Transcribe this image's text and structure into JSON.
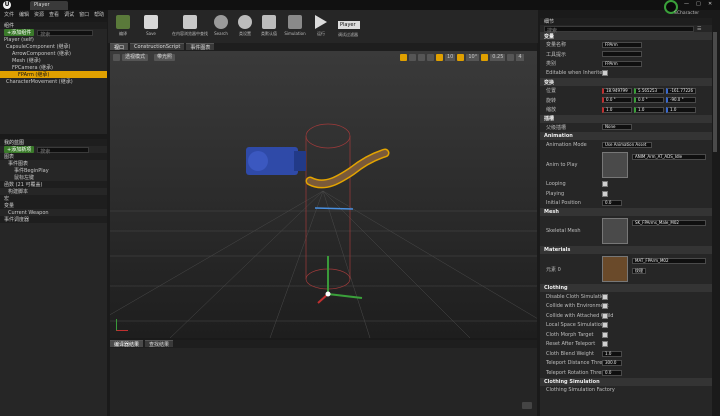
{
  "titlebar": {
    "tab_label": "Player",
    "user_label": "SCharacter"
  },
  "menu": [
    "文件",
    "编辑",
    "资源",
    "查看",
    "调试",
    "窗口",
    "帮助"
  ],
  "toolbar": {
    "buttons": [
      {
        "label": "编译"
      },
      {
        "label": "Save"
      },
      {
        "label": "在内容浏览器中查找"
      },
      {
        "label": "Search"
      },
      {
        "label": "类设置"
      },
      {
        "label": "类默认值"
      },
      {
        "label": "Simulation"
      },
      {
        "label": "运行"
      }
    ],
    "debug_select": "Player",
    "debug_filter": "调试过滤器"
  },
  "components": {
    "header": "组件",
    "add_button": "+添加组件",
    "search_placeholder": "搜索",
    "items": [
      "Player (self)",
      "CapsuleComponent (继承)",
      "ArrowComponent (继承)",
      "Mesh (继承)",
      "FPCamera (继承)",
      "FPArm (继承)",
      "CharacterMovement (继承)"
    ]
  },
  "mybp": {
    "header": "我的蓝图",
    "add_button": "+添加新项",
    "search_placeholder": "搜索",
    "sections": [
      {
        "label": "图表"
      },
      {
        "label": "事件图表"
      },
      {
        "label": "事件BeginPlay"
      },
      {
        "label": "鼠标左键"
      },
      {
        "label": "函数 (21 可覆盖)"
      },
      {
        "label": "构建脚本"
      },
      {
        "label": "宏"
      },
      {
        "label": "变量"
      },
      {
        "label": "Current Weapon"
      },
      {
        "label": "事件调度器"
      }
    ]
  },
  "viewport": {
    "tabs": [
      "视口",
      "ConstructionScript",
      "事件图表"
    ],
    "perspective": "透视模式",
    "lit": "带光照",
    "snap_values": [
      "10",
      "10°",
      "0.25",
      "4"
    ]
  },
  "bottom": {
    "tabs": [
      "编译器结果",
      "查找结果"
    ]
  },
  "details": {
    "tab_label": "细节",
    "search_placeholder": "搜索",
    "sections": {
      "variable": "变量",
      "transform": "变换",
      "sockets": "插槽",
      "animation": "Animation",
      "mesh": "Mesh",
      "materials": "Materials",
      "clothing": "Clothing",
      "clothing_sim": "Clothing Simulation"
    },
    "variable": {
      "name_label": "变量名称",
      "name_value": "FPArm",
      "tooltip_label": "工具提示",
      "category_label": "类别",
      "category_value": "FPArm",
      "editable_label": "Editable when Inherited"
    },
    "transform": {
      "location_label": "位置",
      "rotation_label": "旋转",
      "scale_label": "缩放",
      "location": [
        "18.949799",
        "5.565253",
        "-161.77226"
      ],
      "rotation": [
        "0.0 °",
        "0.0 °",
        "-90.0 °"
      ],
      "scale": [
        "1.0",
        "1.0",
        "1.0"
      ]
    },
    "sockets": {
      "label": "父级插槽",
      "value": "None"
    },
    "animation": {
      "mode_label": "Animation Mode",
      "mode_value": "Use Animation Asset",
      "anim_label": "Anim to Play",
      "anim_value": "ANIM_Arm_AT_ADS_Idle",
      "looping_label": "Looping",
      "playing_label": "Playing",
      "initial_label": "Initial Position",
      "initial_value": "0.0"
    },
    "mesh": {
      "label": "Skeletal Mesh",
      "value": "SK_FPArms_Male_M02"
    },
    "materials": {
      "label": "元素 0",
      "value": "MAT_FPArm_M02",
      "sub": "纹理"
    },
    "clothing": [
      {
        "label": "Disable Cloth Simulation"
      },
      {
        "label": "Collide with Environment"
      },
      {
        "label": "Collide with Attached Child"
      },
      {
        "label": "Local Space Simulation"
      },
      {
        "label": "Cloth Morph Target"
      },
      {
        "label": "Reset After Teleport"
      },
      {
        "label": "Cloth Blend Weight",
        "value": "1.0"
      },
      {
        "label": "Teleport Distance Threshold",
        "value": "300.0"
      },
      {
        "label": "Teleport Rotation Threshold",
        "value": "0.0"
      }
    ],
    "clothing_sim_row": "Clothing Simulation Factory"
  },
  "colors": {
    "accent": "#e0a000",
    "green": "#3a7a2a",
    "bg": "#262626"
  }
}
